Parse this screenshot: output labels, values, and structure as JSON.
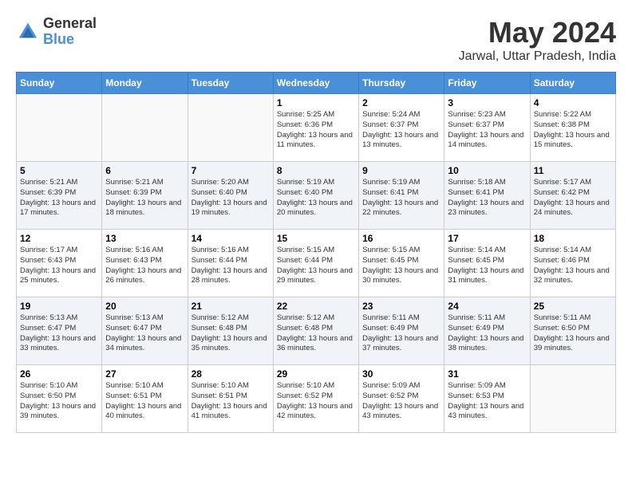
{
  "logo": {
    "line1": "General",
    "line2": "Blue"
  },
  "title": "May 2024",
  "subtitle": "Jarwal, Uttar Pradesh, India",
  "days_of_week": [
    "Sunday",
    "Monday",
    "Tuesday",
    "Wednesday",
    "Thursday",
    "Friday",
    "Saturday"
  ],
  "weeks": [
    [
      {
        "day": "",
        "sunrise": "",
        "sunset": "",
        "daylight": ""
      },
      {
        "day": "",
        "sunrise": "",
        "sunset": "",
        "daylight": ""
      },
      {
        "day": "",
        "sunrise": "",
        "sunset": "",
        "daylight": ""
      },
      {
        "day": "1",
        "sunrise": "Sunrise: 5:25 AM",
        "sunset": "Sunset: 6:36 PM",
        "daylight": "Daylight: 13 hours and 11 minutes."
      },
      {
        "day": "2",
        "sunrise": "Sunrise: 5:24 AM",
        "sunset": "Sunset: 6:37 PM",
        "daylight": "Daylight: 13 hours and 13 minutes."
      },
      {
        "day": "3",
        "sunrise": "Sunrise: 5:23 AM",
        "sunset": "Sunset: 6:37 PM",
        "daylight": "Daylight: 13 hours and 14 minutes."
      },
      {
        "day": "4",
        "sunrise": "Sunrise: 5:22 AM",
        "sunset": "Sunset: 6:38 PM",
        "daylight": "Daylight: 13 hours and 15 minutes."
      }
    ],
    [
      {
        "day": "5",
        "sunrise": "Sunrise: 5:21 AM",
        "sunset": "Sunset: 6:39 PM",
        "daylight": "Daylight: 13 hours and 17 minutes."
      },
      {
        "day": "6",
        "sunrise": "Sunrise: 5:21 AM",
        "sunset": "Sunset: 6:39 PM",
        "daylight": "Daylight: 13 hours and 18 minutes."
      },
      {
        "day": "7",
        "sunrise": "Sunrise: 5:20 AM",
        "sunset": "Sunset: 6:40 PM",
        "daylight": "Daylight: 13 hours and 19 minutes."
      },
      {
        "day": "8",
        "sunrise": "Sunrise: 5:19 AM",
        "sunset": "Sunset: 6:40 PM",
        "daylight": "Daylight: 13 hours and 20 minutes."
      },
      {
        "day": "9",
        "sunrise": "Sunrise: 5:19 AM",
        "sunset": "Sunset: 6:41 PM",
        "daylight": "Daylight: 13 hours and 22 minutes."
      },
      {
        "day": "10",
        "sunrise": "Sunrise: 5:18 AM",
        "sunset": "Sunset: 6:41 PM",
        "daylight": "Daylight: 13 hours and 23 minutes."
      },
      {
        "day": "11",
        "sunrise": "Sunrise: 5:17 AM",
        "sunset": "Sunset: 6:42 PM",
        "daylight": "Daylight: 13 hours and 24 minutes."
      }
    ],
    [
      {
        "day": "12",
        "sunrise": "Sunrise: 5:17 AM",
        "sunset": "Sunset: 6:43 PM",
        "daylight": "Daylight: 13 hours and 25 minutes."
      },
      {
        "day": "13",
        "sunrise": "Sunrise: 5:16 AM",
        "sunset": "Sunset: 6:43 PM",
        "daylight": "Daylight: 13 hours and 26 minutes."
      },
      {
        "day": "14",
        "sunrise": "Sunrise: 5:16 AM",
        "sunset": "Sunset: 6:44 PM",
        "daylight": "Daylight: 13 hours and 28 minutes."
      },
      {
        "day": "15",
        "sunrise": "Sunrise: 5:15 AM",
        "sunset": "Sunset: 6:44 PM",
        "daylight": "Daylight: 13 hours and 29 minutes."
      },
      {
        "day": "16",
        "sunrise": "Sunrise: 5:15 AM",
        "sunset": "Sunset: 6:45 PM",
        "daylight": "Daylight: 13 hours and 30 minutes."
      },
      {
        "day": "17",
        "sunrise": "Sunrise: 5:14 AM",
        "sunset": "Sunset: 6:45 PM",
        "daylight": "Daylight: 13 hours and 31 minutes."
      },
      {
        "day": "18",
        "sunrise": "Sunrise: 5:14 AM",
        "sunset": "Sunset: 6:46 PM",
        "daylight": "Daylight: 13 hours and 32 minutes."
      }
    ],
    [
      {
        "day": "19",
        "sunrise": "Sunrise: 5:13 AM",
        "sunset": "Sunset: 6:47 PM",
        "daylight": "Daylight: 13 hours and 33 minutes."
      },
      {
        "day": "20",
        "sunrise": "Sunrise: 5:13 AM",
        "sunset": "Sunset: 6:47 PM",
        "daylight": "Daylight: 13 hours and 34 minutes."
      },
      {
        "day": "21",
        "sunrise": "Sunrise: 5:12 AM",
        "sunset": "Sunset: 6:48 PM",
        "daylight": "Daylight: 13 hours and 35 minutes."
      },
      {
        "day": "22",
        "sunrise": "Sunrise: 5:12 AM",
        "sunset": "Sunset: 6:48 PM",
        "daylight": "Daylight: 13 hours and 36 minutes."
      },
      {
        "day": "23",
        "sunrise": "Sunrise: 5:11 AM",
        "sunset": "Sunset: 6:49 PM",
        "daylight": "Daylight: 13 hours and 37 minutes."
      },
      {
        "day": "24",
        "sunrise": "Sunrise: 5:11 AM",
        "sunset": "Sunset: 6:49 PM",
        "daylight": "Daylight: 13 hours and 38 minutes."
      },
      {
        "day": "25",
        "sunrise": "Sunrise: 5:11 AM",
        "sunset": "Sunset: 6:50 PM",
        "daylight": "Daylight: 13 hours and 39 minutes."
      }
    ],
    [
      {
        "day": "26",
        "sunrise": "Sunrise: 5:10 AM",
        "sunset": "Sunset: 6:50 PM",
        "daylight": "Daylight: 13 hours and 39 minutes."
      },
      {
        "day": "27",
        "sunrise": "Sunrise: 5:10 AM",
        "sunset": "Sunset: 6:51 PM",
        "daylight": "Daylight: 13 hours and 40 minutes."
      },
      {
        "day": "28",
        "sunrise": "Sunrise: 5:10 AM",
        "sunset": "Sunset: 6:51 PM",
        "daylight": "Daylight: 13 hours and 41 minutes."
      },
      {
        "day": "29",
        "sunrise": "Sunrise: 5:10 AM",
        "sunset": "Sunset: 6:52 PM",
        "daylight": "Daylight: 13 hours and 42 minutes."
      },
      {
        "day": "30",
        "sunrise": "Sunrise: 5:09 AM",
        "sunset": "Sunset: 6:52 PM",
        "daylight": "Daylight: 13 hours and 43 minutes."
      },
      {
        "day": "31",
        "sunrise": "Sunrise: 5:09 AM",
        "sunset": "Sunset: 6:53 PM",
        "daylight": "Daylight: 13 hours and 43 minutes."
      },
      {
        "day": "",
        "sunrise": "",
        "sunset": "",
        "daylight": ""
      }
    ]
  ]
}
